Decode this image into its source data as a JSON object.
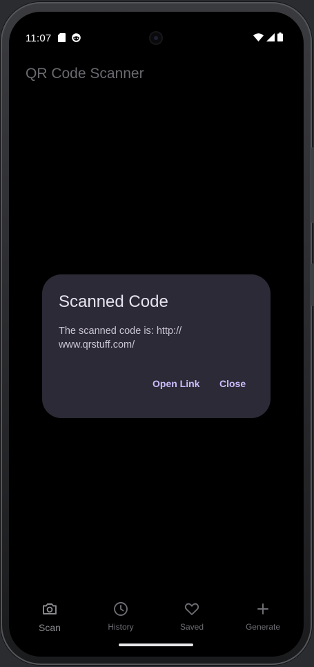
{
  "status_bar": {
    "time": "11:07",
    "icons": [
      "sd-card-icon",
      "face-icon",
      "wifi-icon",
      "signal-icon",
      "battery-icon"
    ]
  },
  "app": {
    "title": "QR Code Scanner"
  },
  "dialog": {
    "title": "Scanned Code",
    "body": "The scanned code is: http://\nwww.qrstuff.com/",
    "open_link_label": "Open Link",
    "close_label": "Close"
  },
  "bottom_nav": {
    "items": [
      {
        "label": "Scan",
        "icon": "camera-icon",
        "active": true
      },
      {
        "label": "History",
        "icon": "clock-icon",
        "active": false
      },
      {
        "label": "Saved",
        "icon": "heart-icon",
        "active": false
      },
      {
        "label": "Generate",
        "icon": "plus-icon",
        "active": false
      }
    ]
  },
  "colors": {
    "background": "#000000",
    "dialog_surface": "#2b2a36",
    "accent": "#cdbdfc",
    "title_text": "#e7e3ee"
  }
}
